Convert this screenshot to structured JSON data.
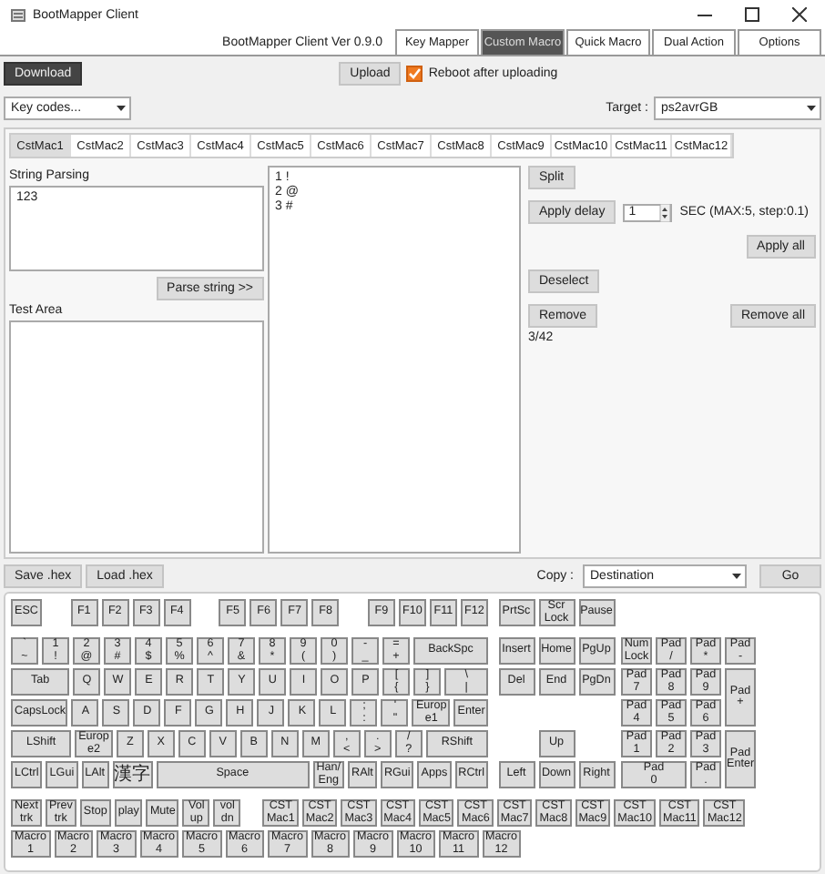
{
  "window": {
    "title": "BootMapper Client"
  },
  "version": "BootMapper Client Ver 0.9.0",
  "tabs": [
    {
      "label": "Key Mapper",
      "selected": false
    },
    {
      "label": "Custom Macro",
      "selected": true
    },
    {
      "label": "Quick Macro",
      "selected": false
    },
    {
      "label": "Dual Action",
      "selected": false
    },
    {
      "label": "Options",
      "selected": false
    }
  ],
  "download_button": "Download",
  "upload": {
    "button": "Upload",
    "reboot": {
      "label": "Reboot after uploading",
      "checked": true
    }
  },
  "key_codes": {
    "value": "Key codes..."
  },
  "target": {
    "label": "Target :",
    "value": "ps2avrGB"
  },
  "macro_tabs": [
    {
      "label": "CstMac1",
      "selected": true
    },
    {
      "label": "CstMac2",
      "selected": false
    },
    {
      "label": "CstMac3",
      "selected": false
    },
    {
      "label": "CstMac4",
      "selected": false
    },
    {
      "label": "CstMac5",
      "selected": false
    },
    {
      "label": "CstMac6",
      "selected": false
    },
    {
      "label": "CstMac7",
      "selected": false
    },
    {
      "label": "CstMac8",
      "selected": false
    },
    {
      "label": "CstMac9",
      "selected": false
    },
    {
      "label": "CstMac10",
      "selected": false
    },
    {
      "label": "CstMac11",
      "selected": false
    },
    {
      "label": "CstMac12",
      "selected": false
    }
  ],
  "string_parsing": {
    "label": "String Parsing",
    "value": "123",
    "button": "Parse string >>"
  },
  "test_area": {
    "label": "Test Area"
  },
  "macro_steps": [
    "1 !",
    "2 @",
    "3 #"
  ],
  "actions": {
    "split": "Split",
    "apply_delay": "Apply delay",
    "delay": {
      "value": "1",
      "unit": "SEC (MAX:5, step:0.1)"
    },
    "apply_all": "Apply all",
    "deselect": "Deselect",
    "remove": "Remove",
    "remove_all": "Remove all",
    "count": "3/42"
  },
  "file_buttons": [
    "Save .hex",
    "Load .hex"
  ],
  "copy": {
    "label": "Copy :",
    "value": "Destination",
    "button": "Go"
  },
  "keyboard": {
    "function_row": {
      "groups": [
        [
          {
            "label": "ESC",
            "kind": "key"
          }
        ],
        [
          {
            "label": "F1",
            "kind": "key"
          },
          {
            "label": "F2",
            "kind": "key"
          },
          {
            "label": "F3",
            "kind": "key"
          },
          {
            "label": "F4",
            "kind": "key"
          }
        ],
        [
          {
            "label": "F5",
            "kind": "key"
          },
          {
            "label": "F6",
            "kind": "key"
          },
          {
            "label": "F7",
            "kind": "key"
          },
          {
            "label": "F8",
            "kind": "key"
          }
        ],
        [
          {
            "label": "F9",
            "kind": "key"
          },
          {
            "label": "F10",
            "kind": "key"
          },
          {
            "label": "F11",
            "kind": "key"
          },
          {
            "label": "F12",
            "kind": "key"
          }
        ]
      ],
      "nav": [
        {
          "label": "PrtSc",
          "kind": "key"
        },
        {
          "label": "Scr\nLock",
          "kind": "key"
        },
        {
          "label": "Pause",
          "kind": "key"
        }
      ]
    },
    "main_rows": [
      {
        "keys": [
          {
            "label": "`\n~",
            "kind": "key"
          },
          {
            "label": "1\n!",
            "kind": "key"
          },
          {
            "label": "2\n@",
            "kind": "key"
          },
          {
            "label": "3\n#",
            "kind": "key"
          },
          {
            "label": "4\n$",
            "kind": "key"
          },
          {
            "label": "5\n%",
            "kind": "key"
          },
          {
            "label": "6\n^",
            "kind": "key"
          },
          {
            "label": "7\n&",
            "kind": "key"
          },
          {
            "label": "8\n*",
            "kind": "key"
          },
          {
            "label": "9\n(",
            "kind": "key"
          },
          {
            "label": "0\n)",
            "kind": "key"
          },
          {
            "label": "-\n_",
            "kind": "key"
          },
          {
            "label": "=\n+",
            "kind": "key"
          },
          {
            "label": "BackSpc",
            "kind": "wide"
          }
        ],
        "nav": [
          {
            "label": "Insert",
            "kind": "key"
          },
          {
            "label": "Home",
            "kind": "key"
          },
          {
            "label": "PgUp",
            "kind": "key"
          }
        ]
      },
      {
        "keys": [
          {
            "label": "Tab",
            "kind": "wide"
          },
          {
            "label": "Q",
            "kind": "key"
          },
          {
            "label": "W",
            "kind": "key"
          },
          {
            "label": "E",
            "kind": "key"
          },
          {
            "label": "R",
            "kind": "key"
          },
          {
            "label": "T",
            "kind": "key"
          },
          {
            "label": "Y",
            "kind": "key"
          },
          {
            "label": "U",
            "kind": "key"
          },
          {
            "label": "I",
            "kind": "key"
          },
          {
            "label": "O",
            "kind": "key"
          },
          {
            "label": "P",
            "kind": "key"
          },
          {
            "label": "[\n{",
            "kind": "key"
          },
          {
            "label": "]\n}",
            "kind": "key"
          },
          {
            "label": "\\\n|",
            "kind": "wide"
          }
        ],
        "nav": [
          {
            "label": "Del",
            "kind": "key"
          },
          {
            "label": "End",
            "kind": "key"
          },
          {
            "label": "PgDn",
            "kind": "key"
          }
        ]
      },
      {
        "keys": [
          {
            "label": "CapsLock",
            "kind": "wide"
          },
          {
            "label": "A",
            "kind": "key"
          },
          {
            "label": "S",
            "kind": "key"
          },
          {
            "label": "D",
            "kind": "key"
          },
          {
            "label": "F",
            "kind": "key"
          },
          {
            "label": "G",
            "kind": "key"
          },
          {
            "label": "H",
            "kind": "key"
          },
          {
            "label": "J",
            "kind": "key"
          },
          {
            "label": "K",
            "kind": "key"
          },
          {
            "label": "L",
            "kind": "key"
          },
          {
            "label": ";\n:",
            "kind": "key"
          },
          {
            "label": "'\n\"",
            "kind": "key"
          },
          {
            "label": "Europ\ne1",
            "kind": "key"
          },
          {
            "label": "Enter",
            "kind": "wide"
          }
        ]
      },
      {
        "keys": [
          {
            "label": "LShift",
            "kind": "wide"
          },
          {
            "label": "Europ\ne2",
            "kind": "key"
          },
          {
            "label": "Z",
            "kind": "key"
          },
          {
            "label": "X",
            "kind": "key"
          },
          {
            "label": "C",
            "kind": "key"
          },
          {
            "label": "V",
            "kind": "key"
          },
          {
            "label": "B",
            "kind": "key"
          },
          {
            "label": "N",
            "kind": "key"
          },
          {
            "label": "M",
            "kind": "key"
          },
          {
            "label": ",\n<",
            "kind": "key"
          },
          {
            "label": ".\n>",
            "kind": "key"
          },
          {
            "label": "/\n?",
            "kind": "key"
          },
          {
            "label": "RShift",
            "kind": "wide"
          }
        ],
        "nav": [
          {
            "label": "Up",
            "kind": "key"
          }
        ]
      },
      {
        "keys": [
          {
            "label": "LCtrl",
            "kind": "key"
          },
          {
            "label": "LGui",
            "kind": "key"
          },
          {
            "label": "LAlt",
            "kind": "key"
          },
          {
            "label": "漢字",
            "kind": "cjk"
          },
          {
            "label": "Space",
            "kind": "space"
          },
          {
            "label": "Han/\nEng",
            "kind": "key"
          },
          {
            "label": "RAlt",
            "kind": "key"
          },
          {
            "label": "RGui",
            "kind": "key"
          },
          {
            "label": "Apps",
            "kind": "key"
          },
          {
            "label": "RCtrl",
            "kind": "key"
          }
        ],
        "nav": [
          {
            "label": "Left",
            "kind": "key"
          },
          {
            "label": "Down",
            "kind": "key"
          },
          {
            "label": "Right",
            "kind": "key"
          }
        ]
      }
    ],
    "numpad": [
      {
        "label": "Num\nLock",
        "kind": "key"
      },
      {
        "label": "Pad\n/",
        "kind": "key"
      },
      {
        "label": "Pad\n*",
        "kind": "key"
      },
      {
        "label": "Pad\n-",
        "kind": "key"
      },
      {
        "label": "Pad\n7",
        "kind": "key"
      },
      {
        "label": "Pad\n8",
        "kind": "key"
      },
      {
        "label": "Pad\n9",
        "kind": "key"
      },
      {
        "label": "Pad\n+",
        "kind": "tall"
      },
      {
        "label": "Pad\n4",
        "kind": "key"
      },
      {
        "label": "Pad\n5",
        "kind": "key"
      },
      {
        "label": "Pad\n6",
        "kind": "key"
      },
      {
        "label": "Pad\n1",
        "kind": "key"
      },
      {
        "label": "Pad\n2",
        "kind": "key"
      },
      {
        "label": "Pad\n3",
        "kind": "key"
      },
      {
        "label": "Pad\nEnter",
        "kind": "tall"
      },
      {
        "label": "Pad\n0",
        "kind": "wide"
      },
      {
        "label": "Pad\n.",
        "kind": "key"
      }
    ],
    "media_keys": [
      {
        "label": "Next\ntrk",
        "kind": "key"
      },
      {
        "label": "Prev\ntrk",
        "kind": "key"
      },
      {
        "label": "Stop",
        "kind": "key"
      },
      {
        "label": "play",
        "kind": "key"
      },
      {
        "label": "Mute",
        "kind": "key"
      },
      {
        "label": "Vol\nup",
        "kind": "key"
      },
      {
        "label": "vol\ndn",
        "kind": "key"
      }
    ],
    "cst_keys": [
      {
        "label": "CST\nMac1",
        "kind": "key"
      },
      {
        "label": "CST\nMac2",
        "kind": "key"
      },
      {
        "label": "CST\nMac3",
        "kind": "key"
      },
      {
        "label": "CST\nMac4",
        "kind": "key"
      },
      {
        "label": "CST\nMac5",
        "kind": "key"
      },
      {
        "label": "CST\nMac6",
        "kind": "key"
      },
      {
        "label": "CST\nMac7",
        "kind": "key"
      },
      {
        "label": "CST\nMac8",
        "kind": "key"
      },
      {
        "label": "CST\nMac9",
        "kind": "key"
      },
      {
        "label": "CST\nMac10",
        "kind": "key"
      },
      {
        "label": "CST\nMac11",
        "kind": "key"
      },
      {
        "label": "CST\nMac12",
        "kind": "key"
      }
    ],
    "macro_keys": [
      {
        "label": "Macro\n1",
        "kind": "key"
      },
      {
        "label": "Macro\n2",
        "kind": "key"
      },
      {
        "label": "Macro\n3",
        "kind": "key"
      },
      {
        "label": "Macro\n4",
        "kind": "key"
      },
      {
        "label": "Macro\n5",
        "kind": "key"
      },
      {
        "label": "Macro\n6",
        "kind": "key"
      },
      {
        "label": "Macro\n7",
        "kind": "key"
      },
      {
        "label": "Macro\n8",
        "kind": "key"
      },
      {
        "label": "Macro\n9",
        "kind": "key"
      },
      {
        "label": "Macro\n10",
        "kind": "key"
      },
      {
        "label": "Macro\n11",
        "kind": "key"
      },
      {
        "label": "Macro\n12",
        "kind": "key"
      }
    ]
  }
}
